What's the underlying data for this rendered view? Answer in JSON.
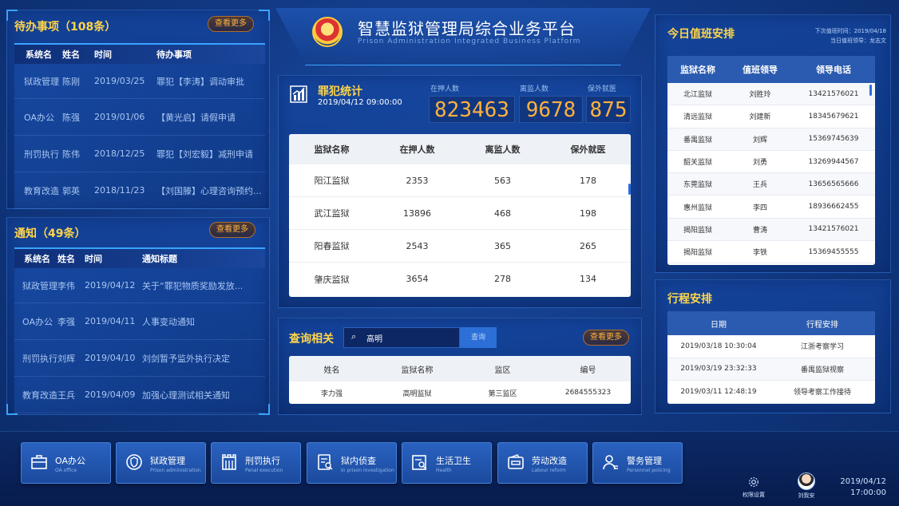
{
  "todo": {
    "title": "待办事项（108条）",
    "more": "查看更多",
    "headers": [
      "系统名",
      "姓名",
      "时间",
      "待办事项"
    ],
    "rows": [
      [
        "狱政管理",
        "陈刚",
        "2019/03/25",
        "罪犯【李涛】调动审批"
      ],
      [
        "OA办公",
        "陈强",
        "2019/01/06",
        "【黄光启】请假申请"
      ],
      [
        "刑罚执行",
        "陈伟",
        "2018/12/25",
        "罪犯【刘宏毅】减刑申请"
      ],
      [
        "教育改造",
        "郭英",
        "2018/11/23",
        "【刘国滕】心理咨询预约..."
      ]
    ]
  },
  "notice": {
    "title": "通知（49条）",
    "more": "查看更多",
    "headers": [
      "系统名",
      "姓名",
      "时间",
      "通知标题"
    ],
    "rows": [
      [
        "狱政管理",
        "李伟",
        "2019/04/12",
        "关于“罪犯物质奖励发放..."
      ],
      [
        "OA办公",
        "李强",
        "2019/04/11",
        "人事变动通知"
      ],
      [
        "刑罚执行",
        "刘辉",
        "2019/04/10",
        "刘剑暂予监外执行决定"
      ],
      [
        "教育改造",
        "王兵",
        "2019/04/09",
        "加强心理测试相关通知"
      ]
    ]
  },
  "header": {
    "title": "智慧监狱管理局综合业务平台",
    "subtitle": "Prison Administration Integrated Business Platform"
  },
  "stats": {
    "title": "罪犯统计",
    "datetime": "2019/04/12 09:00:00",
    "labels": [
      "在押人数",
      "离监人数",
      "保外就医"
    ],
    "values": [
      "823463",
      "9678",
      "875"
    ],
    "table_headers": [
      "监狱名称",
      "在押人数",
      "离监人数",
      "保外就医"
    ],
    "rows": [
      [
        "阳江监狱",
        "2353",
        "563",
        "178"
      ],
      [
        "武江监狱",
        "13896",
        "468",
        "198"
      ],
      [
        "阳春监狱",
        "2543",
        "365",
        "265"
      ],
      [
        "肇庆监狱",
        "3654",
        "278",
        "134"
      ]
    ]
  },
  "query": {
    "title": "查询相关",
    "input_value": "高明",
    "button": "查询",
    "more": "查看更多",
    "headers": [
      "姓名",
      "监狱名称",
      "监区",
      "编号"
    ],
    "rows": [
      [
        "李力强",
        "高明监狱",
        "第三监区",
        "2684555323"
      ]
    ]
  },
  "duty": {
    "title": "今日值班安排",
    "next_duty": "下次值班时间：2019/04/18",
    "leader": "当日值班领导：龙志文",
    "headers": [
      "监狱名称",
      "值班领导",
      "领导电话"
    ],
    "rows": [
      [
        "北江监狱",
        "刘胜玲",
        "13421576021"
      ],
      [
        "清远监狱",
        "刘建新",
        "18345679621"
      ],
      [
        "番禺监狱",
        "刘辉",
        "15369745639"
      ],
      [
        "韶关监狱",
        "刘勇",
        "13269944567"
      ],
      [
        "东莞监狱",
        "王兵",
        "13656565666"
      ],
      [
        "惠州监狱",
        "李四",
        "18936662455"
      ],
      [
        "揭阳监狱",
        "曹涛",
        "13421576021"
      ],
      [
        "揭阳监狱",
        "李铁",
        "15369455555"
      ]
    ]
  },
  "schedule": {
    "title": "行程安排",
    "headers": [
      "日期",
      "行程安排"
    ],
    "rows": [
      [
        "2019/03/18 10:30:04",
        "江浙考察学习"
      ],
      [
        "2019/03/19 23:32:33",
        "番禺监狱视察"
      ],
      [
        "2019/03/11 12:48:19",
        "领导考察工作接待"
      ]
    ]
  },
  "dock": [
    {
      "label": "OA办公",
      "sub": "OA office",
      "icon": "briefcase-icon"
    },
    {
      "label": "狱政管理",
      "sub": "Prison administration",
      "icon": "shield-icon"
    },
    {
      "label": "刑罚执行",
      "sub": "Penal execution",
      "icon": "building-icon"
    },
    {
      "label": "狱内侦查",
      "sub": "In prison investigation",
      "icon": "document-search-icon"
    },
    {
      "label": "生活卫生",
      "sub": "Health",
      "icon": "clipboard-search-icon"
    },
    {
      "label": "劳动改造",
      "sub": "Labour reform",
      "icon": "wallet-icon"
    },
    {
      "label": "警务管理",
      "sub": "Personnel policing",
      "icon": "user-icon"
    }
  ],
  "footer": {
    "settings": "权限设置",
    "user": "刘我安",
    "date": "2019/04/12",
    "time": "17:00:00"
  }
}
